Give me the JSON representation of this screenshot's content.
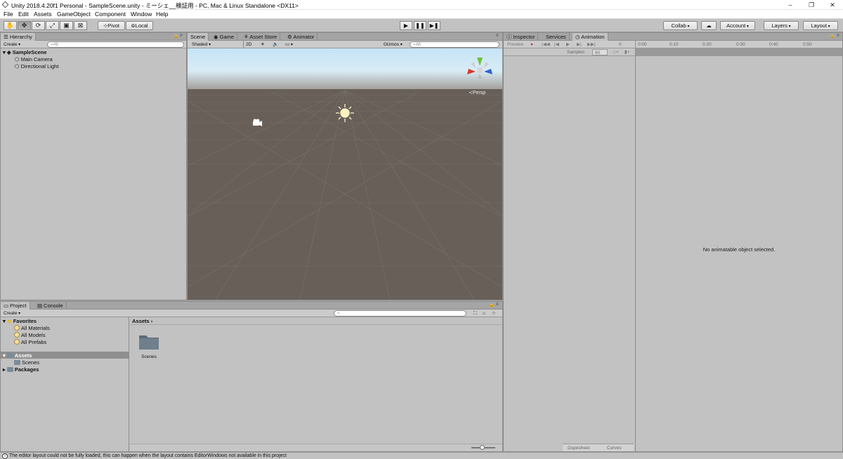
{
  "window": {
    "title": "Unity 2018.4.20f1 Personal - SampleScene.unity - ミーシェ__検証用 - PC, Mac & Linux Standalone <DX11>",
    "controls": [
      "–",
      "❐",
      "✕"
    ]
  },
  "menubar": [
    "File",
    "Edit",
    "Assets",
    "GameObject",
    "Component",
    "Window",
    "Help"
  ],
  "toolbar": {
    "tools": [
      "hand-tool-icon",
      "move-tool-icon",
      "rotate-tool-icon",
      "scale-tool-icon",
      "rect-tool-icon",
      "transform-tool-icon"
    ],
    "pivot": "Pivot",
    "local": "Local",
    "collab": "Collab",
    "account": "Account",
    "layers": "Layers",
    "layout": "Layout"
  },
  "hierarchy": {
    "tab": "Hierarchy",
    "create": "Create",
    "search_placeholder": "All",
    "scene": "SampleScene",
    "items": [
      "Main Camera",
      "Directional Light"
    ]
  },
  "scene_view": {
    "tabs": [
      "Scene",
      "Game",
      "Asset Store",
      "Animator"
    ],
    "shading": "Shaded",
    "mode_2d": "2D",
    "gizmos": "Gizmos",
    "search_placeholder": "All",
    "persp_label": "Persp"
  },
  "right_panel": {
    "tabs": [
      "Inspector",
      "Services",
      "Animation"
    ],
    "preview": "Preview",
    "frame": "0",
    "samples_label": "Samples",
    "samples_value": "60",
    "timeline": [
      "0:00",
      "0:10",
      "0:20",
      "0:30",
      "0:40",
      "0:50"
    ],
    "message": "No animatable object selected.",
    "bottom_tabs": [
      "Dopesheet",
      "Curves"
    ]
  },
  "project": {
    "tabs": [
      "Project",
      "Console"
    ],
    "create": "Create",
    "favorites": "Favorites",
    "favorite_items": [
      "All Materials",
      "All Models",
      "All Prefabs"
    ],
    "assets": "Assets",
    "asset_children": [
      "Scenes"
    ],
    "packages": "Packages",
    "breadcrumb": "Assets",
    "grid_items": [
      "Scenes"
    ]
  },
  "statusbar": {
    "message": "The editor layout could not be fully loaded, this can happen when the layout contains EditorWindows not available in this project"
  },
  "colors": {
    "panel": "#c2c2c2",
    "scene_ground": "#675f58",
    "sky_top": "#c5e4f7",
    "gizmo_y": "#6ec23a",
    "gizmo_x": "#d8382c",
    "gizmo_z": "#2f64d6"
  }
}
